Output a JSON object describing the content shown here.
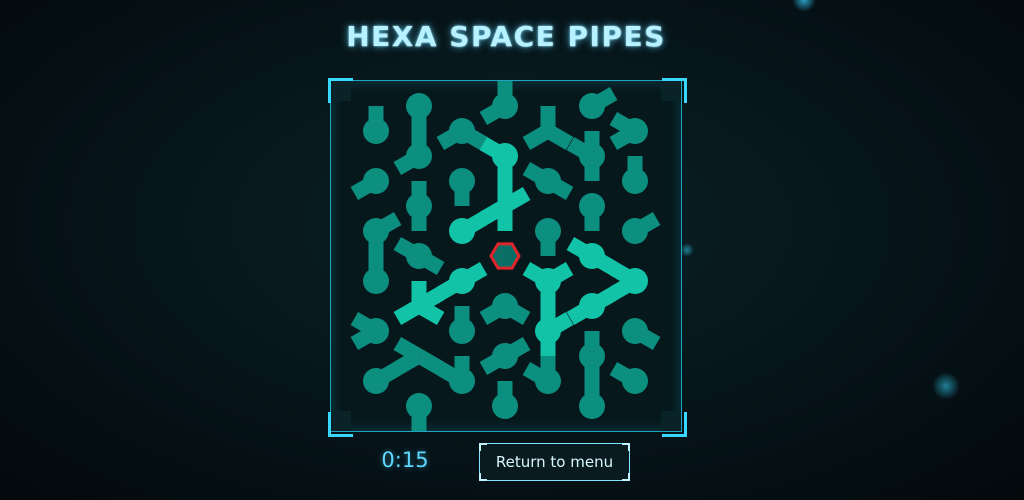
{
  "game": {
    "title": "HEXA SPACE PIPES",
    "timer": "0:15",
    "return_button_label": "Return to menu"
  },
  "colors": {
    "background": "#061419",
    "board_border": "#1fa4bf",
    "corner_accent": "#38d7ff",
    "pipe_inactive": "#0c8f7f",
    "pipe_active": "#12c3a8",
    "source_hex": "#e0262b",
    "title": "#b8f1ff",
    "timer": "#5fd8ff"
  },
  "icons": {
    "source": "hexagon-source-icon",
    "pipe": "pipe-segment-icon"
  }
}
